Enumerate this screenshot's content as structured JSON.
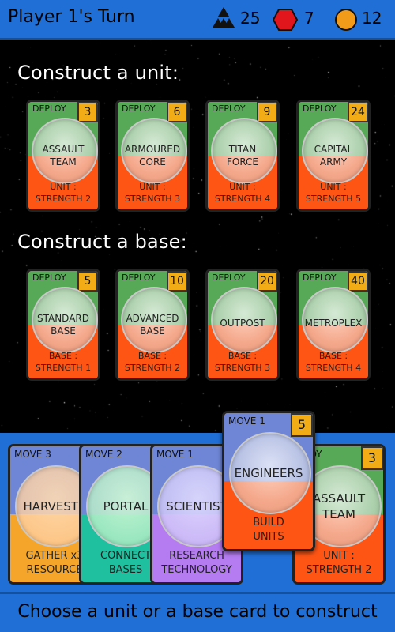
{
  "header": {
    "title": "Player 1's Turn",
    "resources": [
      {
        "icon": "triangles-icon",
        "value": "25"
      },
      {
        "icon": "red-hexagon-icon",
        "value": "7",
        "color": "#e0161c"
      },
      {
        "icon": "orange-circle-icon",
        "value": "12",
        "color": "#f29a1a"
      }
    ]
  },
  "units": {
    "heading": "Construct a unit:",
    "cards": [
      {
        "tag": "DEPLOY",
        "cost": "3",
        "name_line1": "ASSAULT",
        "name_line2": "TEAM",
        "desc_line1": "UNIT :",
        "desc_line2": "STRENGTH 2"
      },
      {
        "tag": "DEPLOY",
        "cost": "6",
        "name_line1": "ARMOURED",
        "name_line2": "CORE",
        "desc_line1": "UNIT :",
        "desc_line2": "STRENGTH 3"
      },
      {
        "tag": "DEPLOY",
        "cost": "9",
        "name_line1": "TITAN",
        "name_line2": "FORCE",
        "desc_line1": "UNIT :",
        "desc_line2": "STRENGTH 4"
      },
      {
        "tag": "DEPLOY",
        "cost": "24",
        "name_line1": "CAPITAL",
        "name_line2": "ARMY",
        "desc_line1": "UNIT :",
        "desc_line2": "STRENGTH 5"
      }
    ]
  },
  "bases": {
    "heading": "Construct a base:",
    "cards": [
      {
        "tag": "DEPLOY",
        "cost": "5",
        "name_line1": "STANDARD",
        "name_line2": "BASE",
        "desc_line1": "BASE :",
        "desc_line2": "STRENGTH 1"
      },
      {
        "tag": "DEPLOY",
        "cost": "10",
        "name_line1": "ADVANCED",
        "name_line2": "BASE",
        "desc_line1": "BASE :",
        "desc_line2": "STRENGTH 2"
      },
      {
        "tag": "DEPLOY",
        "cost": "20",
        "name_line1": "OUTPOST",
        "name_line2": "",
        "desc_line1": "BASE :",
        "desc_line2": "STRENGTH 3"
      },
      {
        "tag": "DEPLOY",
        "cost": "40",
        "name_line1": "METROPLEX",
        "name_line2": "",
        "desc_line1": "BASE :",
        "desc_line2": "STRENGTH 4"
      }
    ]
  },
  "hand": {
    "cards": [
      {
        "tag": "MOVE 3",
        "cost": "",
        "name": "HARVESTE",
        "desc_line1": "GATHER x3",
        "desc_line2": "RESOURCE",
        "top": "#6f86d6",
        "bottom": "#f4a52a",
        "circle": "rgba(255,205,150,0.85)"
      },
      {
        "tag": "MOVE 2",
        "cost": "",
        "name": "PORTAL",
        "desc_line1": "CONNECT",
        "desc_line2": "BASES",
        "top": "#6f86d6",
        "bottom": "#1fc0a0",
        "circle": "rgba(190,240,200,0.85)"
      },
      {
        "tag": "MOVE 1",
        "cost": "",
        "name": "SCIENTIST",
        "desc_line1": "RESEARCH",
        "desc_line2": "TECHNOLOGY",
        "top": "#6f86d6",
        "bottom": "#b47cf0",
        "circle": "rgba(215,205,250,0.85)"
      },
      {
        "tag": "PLOY",
        "cost": "3",
        "name_line1": "ASSAULT",
        "name_line2": "TEAM",
        "desc_line1": "UNIT :",
        "desc_line2": "STRENGTH 2"
      },
      {
        "tag": "MOVE 1",
        "cost": "5",
        "name": "ENGINEERS",
        "desc_line1": "BUILD",
        "desc_line2": "UNITS",
        "top": "#6f86d6",
        "bottom": "#ff5514"
      }
    ]
  },
  "status": "Choose a unit or a base card to construct"
}
